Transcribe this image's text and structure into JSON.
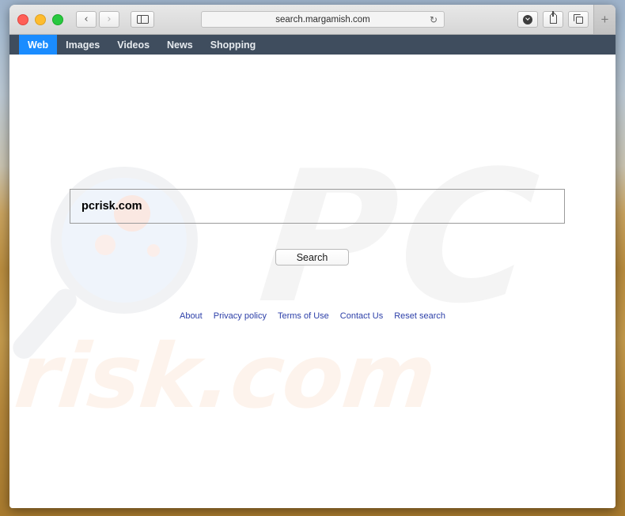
{
  "browser": {
    "url": "search.margamish.com",
    "traffic_lights": [
      {
        "name": "close",
        "color": "#ff5f57"
      },
      {
        "name": "minimize",
        "color": "#febc2e"
      },
      {
        "name": "zoom",
        "color": "#28c840"
      }
    ],
    "back_glyph": "‹",
    "forward_glyph": "›",
    "reload_glyph": "↻",
    "new_tab_label": "+"
  },
  "site_nav": {
    "items": [
      {
        "label": "Web",
        "active": true
      },
      {
        "label": "Images",
        "active": false
      },
      {
        "label": "Videos",
        "active": false
      },
      {
        "label": "News",
        "active": false
      },
      {
        "label": "Shopping",
        "active": false
      }
    ],
    "active_color": "#1a8cff",
    "bar_color": "#3f4d5e"
  },
  "search": {
    "value": "pcrisk.com",
    "placeholder": "",
    "button_label": "Search"
  },
  "footer": {
    "links": [
      {
        "label": "About"
      },
      {
        "label": "Privacy policy"
      },
      {
        "label": "Terms of Use"
      },
      {
        "label": "Contact Us"
      },
      {
        "label": "Reset search"
      }
    ],
    "link_color": "#2c3fa8"
  },
  "watermarks": {
    "pc_text": "PC",
    "risk_text": "risk.com",
    "pc_color": "#f4f4f4",
    "risk_color": "#fdf3ec"
  }
}
